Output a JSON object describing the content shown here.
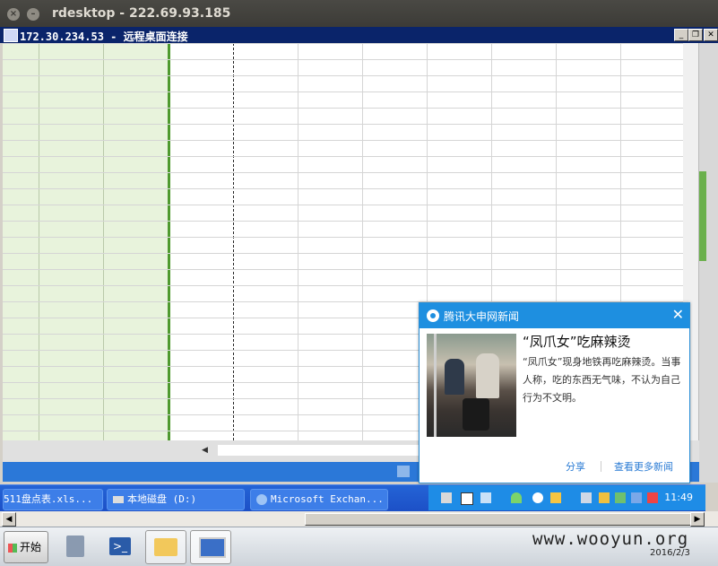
{
  "outer_window": {
    "title": "rdesktop - 222.69.93.185"
  },
  "remote_window": {
    "title": "172.30.234.53 - 远程桌面连接"
  },
  "taskbar": {
    "tasks": [
      "511盘点表.xls...",
      "本地磁盘 (D:)",
      "Microsoft Exchan..."
    ],
    "clock": "11:49"
  },
  "popup": {
    "app_title": "腾讯大申网新闻",
    "headline": "“凤爪女”吃麻辣烫",
    "summary": "“凤爪女”现身地铁再吃麻辣烫。当事人称，吃的东西无气味，不认为自己行为不文明。",
    "share_label": "分享",
    "more_label": "查看更多新闻"
  },
  "host_taskbar": {
    "start_label": "开始",
    "date": "2016/2/3"
  },
  "watermark": "www.wooyun.org",
  "colors": {
    "accent": "#1e8fe0",
    "green_cells": "#e8f3dc",
    "selection_border": "#4f9a2f"
  }
}
